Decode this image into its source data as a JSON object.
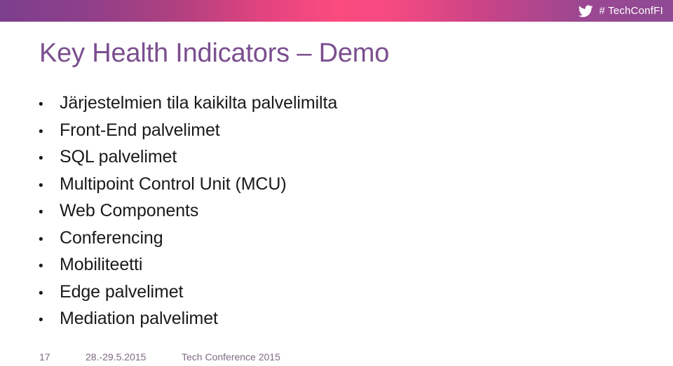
{
  "topbar": {
    "twitter_icon": "twitter-bird-icon",
    "hashtag": "# TechConfFI",
    "gradient_left": "#7c3f8d",
    "gradient_mid": "#fb4b7f",
    "gradient_right": "#8e4a94"
  },
  "title": {
    "text": "Key Health Indicators – Demo",
    "color": "#7b4f8f"
  },
  "bullets": {
    "marker": "•",
    "items": [
      {
        "label": "Järjestelmien tila kaikilta palvelimilta"
      },
      {
        "label": "Front-End palvelimet"
      },
      {
        "label": "SQL palvelimet"
      },
      {
        "label": "Multipoint Control Unit (MCU)"
      },
      {
        "label": "Web Components"
      },
      {
        "label": "Conferencing"
      },
      {
        "label": "Mobiliteetti"
      },
      {
        "label": "Edge palvelimet"
      },
      {
        "label": "Mediation palvelimet"
      }
    ]
  },
  "footer": {
    "slide_number": "17",
    "dates": "28.-29.5.2015",
    "event": "Tech Conference 2015",
    "color": "#7f6a83"
  }
}
